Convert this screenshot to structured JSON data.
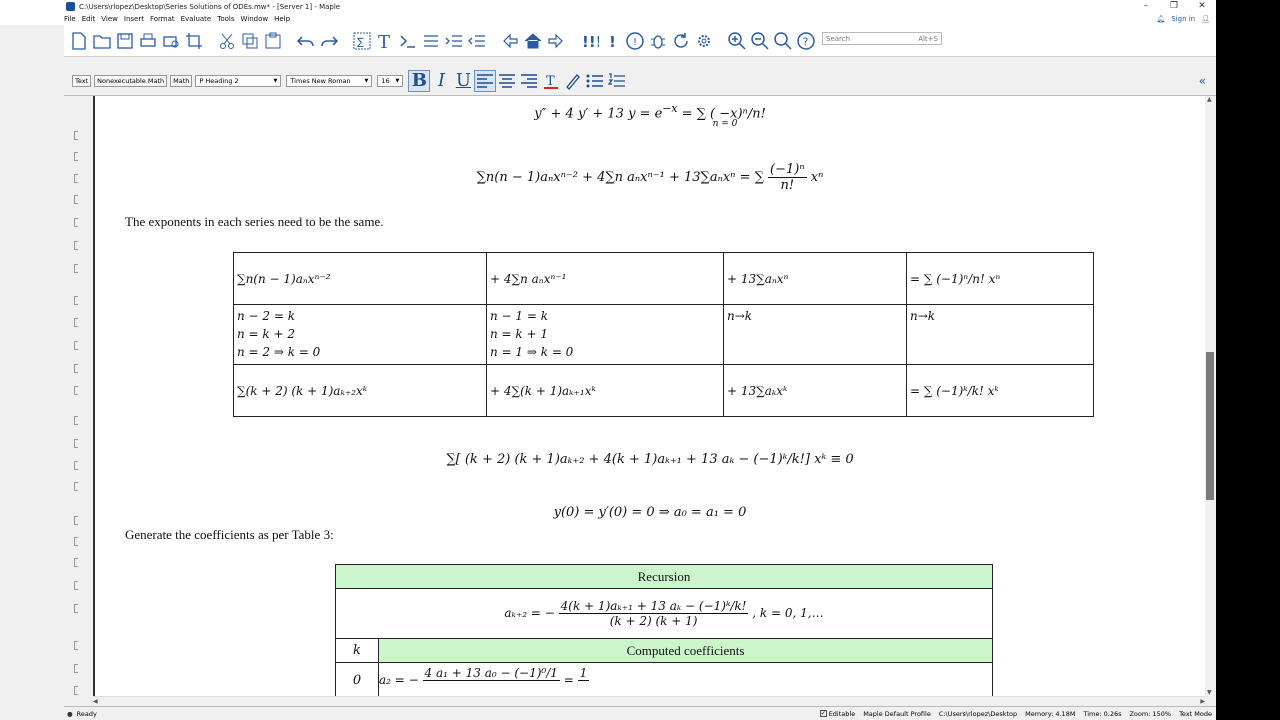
{
  "window": {
    "title": "C:\\Users\\rlopez\\Desktop\\Series Solutions of ODEs.mw* - [Server 1] - Maple",
    "controls": [
      "–",
      "❐",
      "✕"
    ]
  },
  "menu": {
    "items": [
      "File",
      "Edit",
      "View",
      "Insert",
      "Format",
      "Evaluate",
      "Tools",
      "Window",
      "Help"
    ],
    "sign_in": "Sign in"
  },
  "toolbar": {
    "search_placeholder": "Search",
    "search_shortcut": "Alt+S"
  },
  "formatbar": {
    "text_btn": "Text",
    "nonexec_btn": "Nonexecutable Math",
    "math_btn": "Math",
    "style": "P  Heading 2",
    "font": "Times New Roman",
    "size": "16"
  },
  "doc": {
    "eq1": "y″ + 4 y′ + 13 y = e",
    "eq1_exp": "−x",
    "eq1_rhs": "= ∑ ( −x)ⁿ/n!",
    "eq1_sub": "n = 0",
    "eq2": "∑n(n − 1)aₙxⁿ⁻² + 4∑n aₙxⁿ⁻¹ + 13∑aₙxⁿ = ∑",
    "eq2_frac_num": "(−1)ⁿ",
    "eq2_frac_den": "n!",
    "eq2_tail": "xⁿ",
    "para1": "The exponents in each series need to be the same.",
    "table1": {
      "row1": [
        "∑n(n − 1)aₙxⁿ⁻²",
        "+ 4∑n aₙxⁿ⁻¹",
        "+ 13∑aₙxⁿ",
        "= ∑ (−1)ⁿ/n! xⁿ"
      ],
      "row2": [
        [
          "n − 2 = k",
          "n = k + 2",
          "n = 2 ⇒ k = 0"
        ],
        [
          "n − 1 = k",
          "n = k + 1",
          "n = 1 ⇒ k = 0"
        ],
        [
          "n→k"
        ],
        [
          "n→k"
        ]
      ],
      "row3": [
        "∑(k + 2) (k + 1)aₖ₊₂xᵏ",
        "+ 4∑(k + 1)aₖ₊₁xᵏ",
        "+ 13∑aₖxᵏ",
        "= ∑ (−1)ᵏ/k! xᵏ"
      ]
    },
    "eq3": "∑[ (k + 2) (k + 1)aₖ₊₂ + 4(k + 1)aₖ₊₁ + 13 aₖ − (−1)ᵏ/k!] xᵏ ≡ 0",
    "eq4": "y(0) = y′(0) = 0 ⇒ a₀ = a₁ = 0",
    "para2": "Generate the coefficients as per Table 3:",
    "rec_table": {
      "header": "Recursion",
      "recursion_lhs": "aₖ₊₂ = −",
      "recursion_num": "4(k + 1)aₖ₊₁ + 13 aₖ − (−1)ᵏ/k!",
      "recursion_den": "(k + 2) (k + 1)",
      "recursion_tail": ", k = 0, 1,…",
      "k_label": "k",
      "computed_label": "Computed coefficients",
      "row0_k": "0",
      "row0_lhs": "a₂ = −",
      "row0_num": "4 a₁ + 13 a₀ − (−1)⁰/1",
      "row0_rhs": "=",
      "row0_val": "1"
    }
  },
  "statusbar": {
    "ready": "Ready",
    "editable": "Editable",
    "profile": "Maple Default Profile",
    "path": "C:\\Users\\rlopez\\Desktop",
    "memory": "Memory: 4.18M",
    "time": "Time: 0.26s",
    "zoom": "Zoom: 150%",
    "mode": "Text Mode"
  }
}
